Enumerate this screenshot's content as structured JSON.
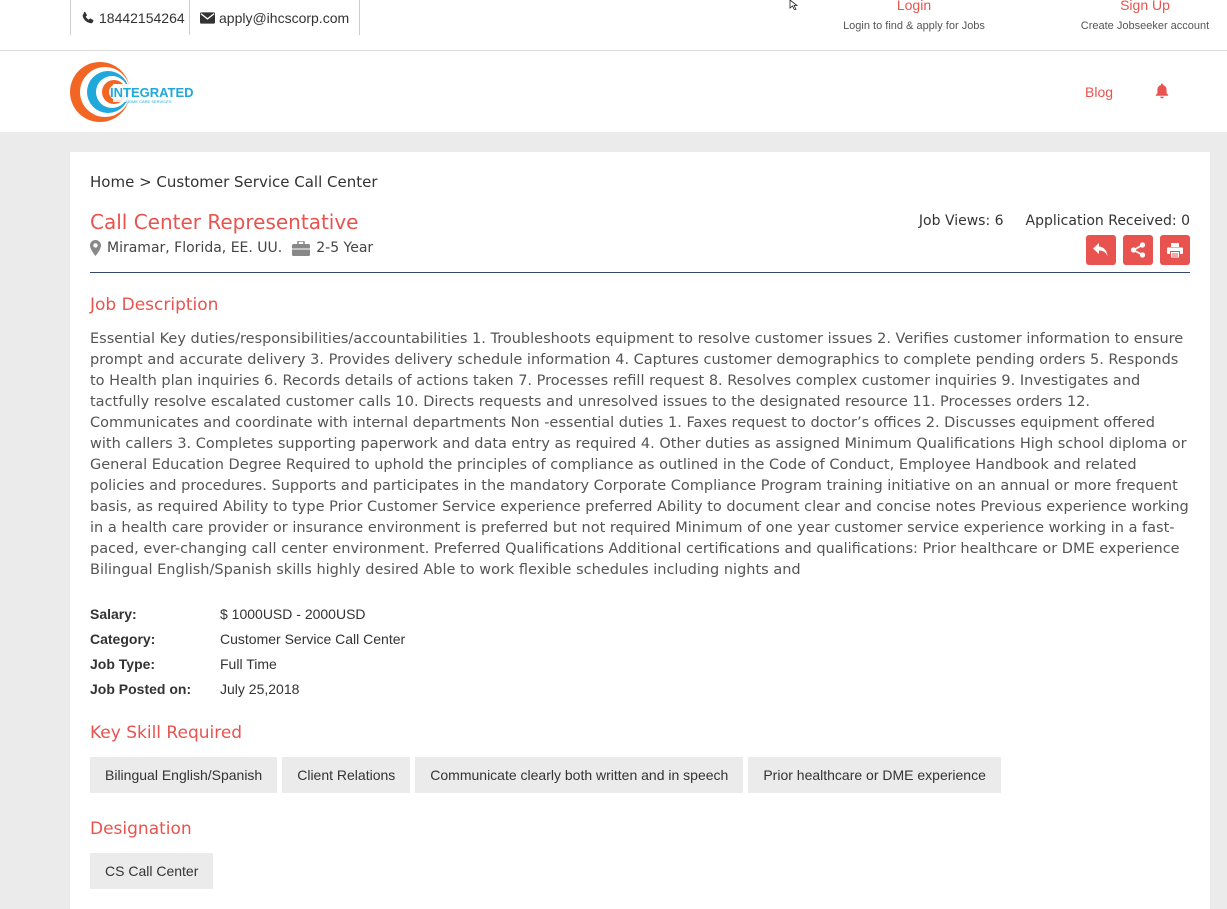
{
  "topbar": {
    "phone": "18442154264",
    "email": "apply@ihcscorp.com",
    "login": {
      "label": "Login",
      "sub": "Login to find & apply for Jobs"
    },
    "signup": {
      "label": "Sign Up",
      "sub": "Create Jobseeker account"
    }
  },
  "nav": {
    "logo_text": "INTEGRATED",
    "logo_sub": "HOME CARE SERVICES",
    "blog": "Blog"
  },
  "colors": {
    "accent": "#e8534f",
    "logo_blue": "#1fa8d9",
    "logo_orange": "#f26522"
  },
  "breadcrumb": "Home > Customer Service Call Center",
  "job": {
    "title": "Call Center Representative",
    "location": "Miramar, Florida, EE. UU.",
    "experience": "2-5 Year",
    "views": "Job Views: 6",
    "applications": "Application Received: 0"
  },
  "sections": {
    "description_heading": "Job Description",
    "skills_heading": "Key Skill Required",
    "designation_heading": "Designation"
  },
  "description": "Essential Key duties/responsibilities/accountabilities 1. Troubleshoots equipment to resolve customer issues 2. Verifies customer information to ensure prompt and accurate delivery 3. Provides delivery schedule information 4. Captures customer demographics to complete pending orders 5. Responds to Health plan inquiries 6. Records details of actions taken 7. Processes refill request 8. Resolves complex customer inquiries 9. Investigates and tactfully resolve escalated customer calls 10. Directs requests and unresolved issues to the designated resource 11. Processes orders 12. Communicates and coordinate with internal departments Non -essential duties 1. Faxes request to doctor’s offices 2. Discusses equipment offered with callers 3. Completes supporting paperwork and data entry as required 4. Other duties as assigned Minimum Qualifications High school diploma or General Education Degree Required to uphold the principles of compliance as outlined in the Code of Conduct, Employee Handbook and related policies and procedures. Supports and participates in the mandatory Corporate Compliance Program training initiative on an annual or more frequent basis, as required Ability to type Prior Customer Service experience preferred Ability to document clear and concise notes Previous experience working in a health care provider or insurance environment is preferred but not required Minimum of one year customer service experience working in a fast-paced, ever-changing call center environment. Preferred Qualifications Additional certifications and qualifications: Prior healthcare or DME experience Bilingual English/Spanish skills highly desired Able to work flexible schedules including nights and",
  "details": [
    {
      "label": "Salary:",
      "value": "$ 1000USD - 2000USD"
    },
    {
      "label": "Category:",
      "value": "Customer Service Call Center"
    },
    {
      "label": "Job Type:",
      "value": "Full Time"
    },
    {
      "label": "Job Posted on:",
      "value": "July 25,2018"
    }
  ],
  "skills": [
    "Bilingual English/Spanish",
    "Client Relations",
    "Communicate clearly both written and in speech",
    "Prior healthcare or DME experience"
  ],
  "designations": [
    "CS Call Center"
  ],
  "icons": [
    "phone-icon",
    "envelope-icon",
    "bell-icon",
    "map-marker-icon",
    "briefcase-icon",
    "reply-icon",
    "share-icon",
    "print-icon",
    "cursor-icon"
  ]
}
